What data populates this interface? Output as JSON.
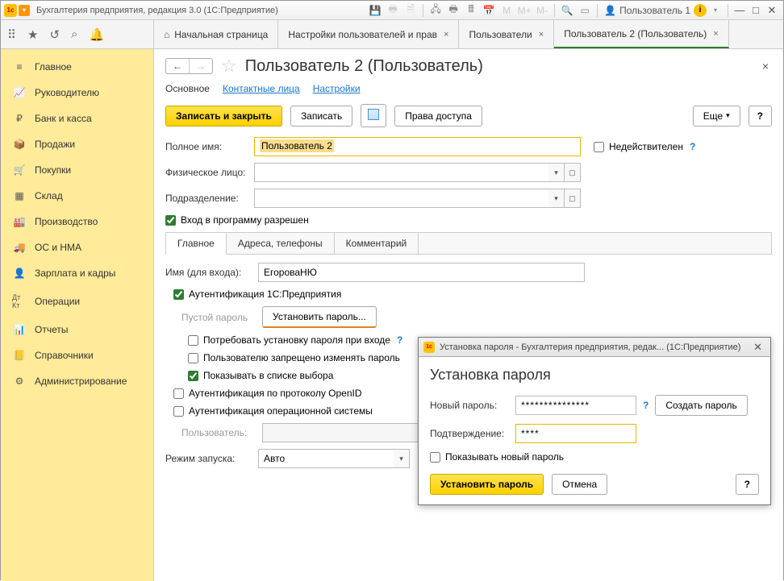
{
  "titlebar": {
    "app_title": "Бухгалтерия предприятия, редакция 3.0  (1С:Предприятие)",
    "user_label": "Пользователь 1"
  },
  "tabs": {
    "t0": "Начальная страница",
    "t1": "Настройки пользователей и прав",
    "t2": "Пользователи",
    "t3": "Пользователь 2 (Пользователь)"
  },
  "sidebar": {
    "items": {
      "main": "Главное",
      "lead": "Руководителю",
      "bank": "Банк и касса",
      "sales": "Продажи",
      "purch": "Покупки",
      "stock": "Склад",
      "prod": "Производство",
      "os": "ОС и НМА",
      "salary": "Зарплата и кадры",
      "ops": "Операции",
      "reports": "Отчеты",
      "refs": "Справочники",
      "admin": "Администрирование"
    }
  },
  "page": {
    "title": "Пользователь 2 (Пользователь)",
    "subtabs": {
      "main": "Основное",
      "contacts": "Контактные лица",
      "settings": "Настройки"
    },
    "buttons": {
      "save_close": "Записать и закрыть",
      "save": "Записать",
      "rights": "Права доступа",
      "more": "Еще",
      "help": "?"
    },
    "labels": {
      "full_name": "Полное имя:",
      "full_name_value": "Пользователь 2",
      "invalid": "Недействителен",
      "phys": "Физическое лицо:",
      "dept": "Подразделение:",
      "login_allowed": "Вход в программу разрешен",
      "login_name": "Имя (для входа):",
      "login_value": "ЕгороваНЮ",
      "auth_1c": "Аутентификация 1С:Предприятия",
      "empty_pwd": "Пустой пароль",
      "set_pwd": "Установить пароль...",
      "require_set": "Потребовать установку пароля при входе",
      "forbid_change": "Пользователю запрещено изменять пароль",
      "show_in_list": "Показывать в списке выбора",
      "auth_openid": "Аутентификация по протоколу OpenID",
      "auth_os": "Аутентификация операционной системы",
      "os_user": "Пользователь:",
      "launch_mode": "Режим запуска:",
      "launch_value": "Авто"
    },
    "inner_tabs": {
      "main": "Главное",
      "addr": "Адреса, телефоны",
      "comment": "Комментарий"
    }
  },
  "dialog": {
    "title": "Установка пароля - Бухгалтерия предприятия, редак... (1С:Предприятие)",
    "heading": "Установка пароля",
    "new_pwd": "Новый пароль:",
    "new_pwd_val": "***************",
    "confirm": "Подтверждение:",
    "confirm_val": "****",
    "gen": "Создать пароль",
    "show": "Показывать новый пароль",
    "set": "Установить пароль",
    "cancel": "Отмена",
    "help": "?"
  }
}
